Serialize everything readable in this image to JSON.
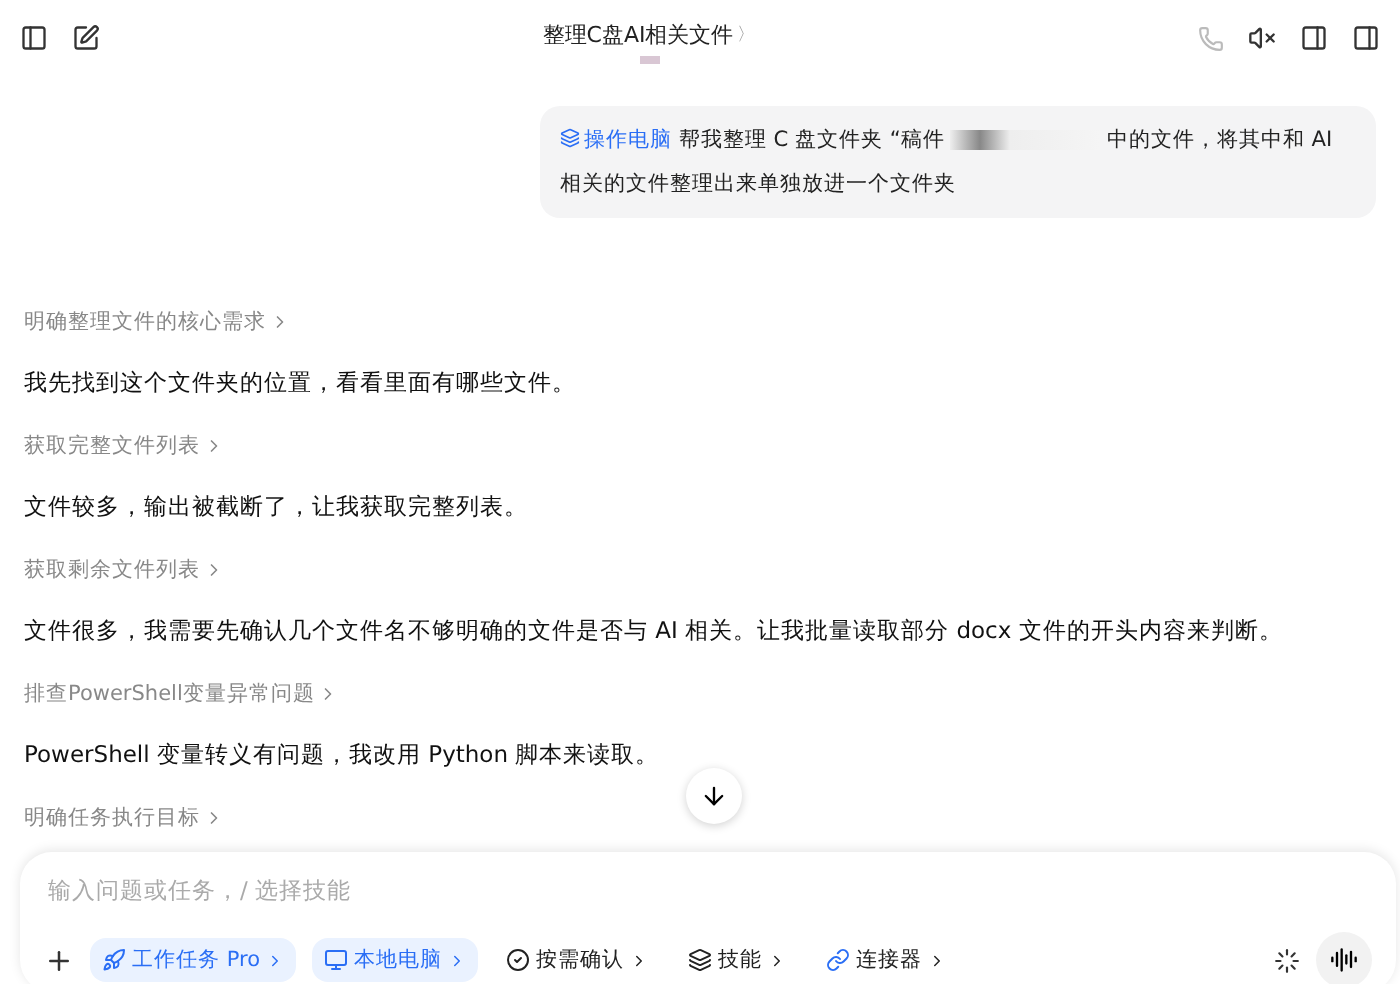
{
  "header": {
    "title": "整理C盘AI相关文件",
    "title_chevron": "〉"
  },
  "user_message": {
    "tag": "操作电脑",
    "text_before": "帮我整理 C 盘文件夹 “稿件",
    "text_after": "中的文件，将其中和 AI 相关的文件整理出来单独放进一个文件夹"
  },
  "steps": [
    {
      "kind": "step",
      "label": "明确整理文件的核心需求"
    },
    {
      "kind": "reply",
      "text": "我先找到这个文件夹的位置，看看里面有哪些文件。"
    },
    {
      "kind": "step",
      "label": "获取完整文件列表"
    },
    {
      "kind": "reply",
      "text": "文件较多，输出被截断了，让我获取完整列表。"
    },
    {
      "kind": "step",
      "label": "获取剩余文件列表"
    },
    {
      "kind": "reply",
      "text": "文件很多，我需要先确认几个文件名不够明确的文件是否与 AI 相关。让我批量读取部分 docx 文件的开头内容来判断。"
    },
    {
      "kind": "step",
      "label": "排查PowerShell变量异常问题"
    },
    {
      "kind": "reply",
      "text": "PowerShell 变量转义有问题，我改用 Python 脚本来读取。"
    },
    {
      "kind": "step",
      "label": "明确任务执行目标"
    }
  ],
  "composer": {
    "placeholder": "输入问题或任务，/ 选择技能",
    "chips": [
      {
        "kind": "task",
        "label": "工作任务 Pro",
        "selected": true
      },
      {
        "kind": "computer",
        "label": "本地电脑",
        "selected": true
      },
      {
        "kind": "confirm",
        "label": "按需确认",
        "selected": false
      },
      {
        "kind": "skills",
        "label": "技能",
        "selected": false
      },
      {
        "kind": "connector",
        "label": "连接器",
        "selected": false
      }
    ]
  }
}
